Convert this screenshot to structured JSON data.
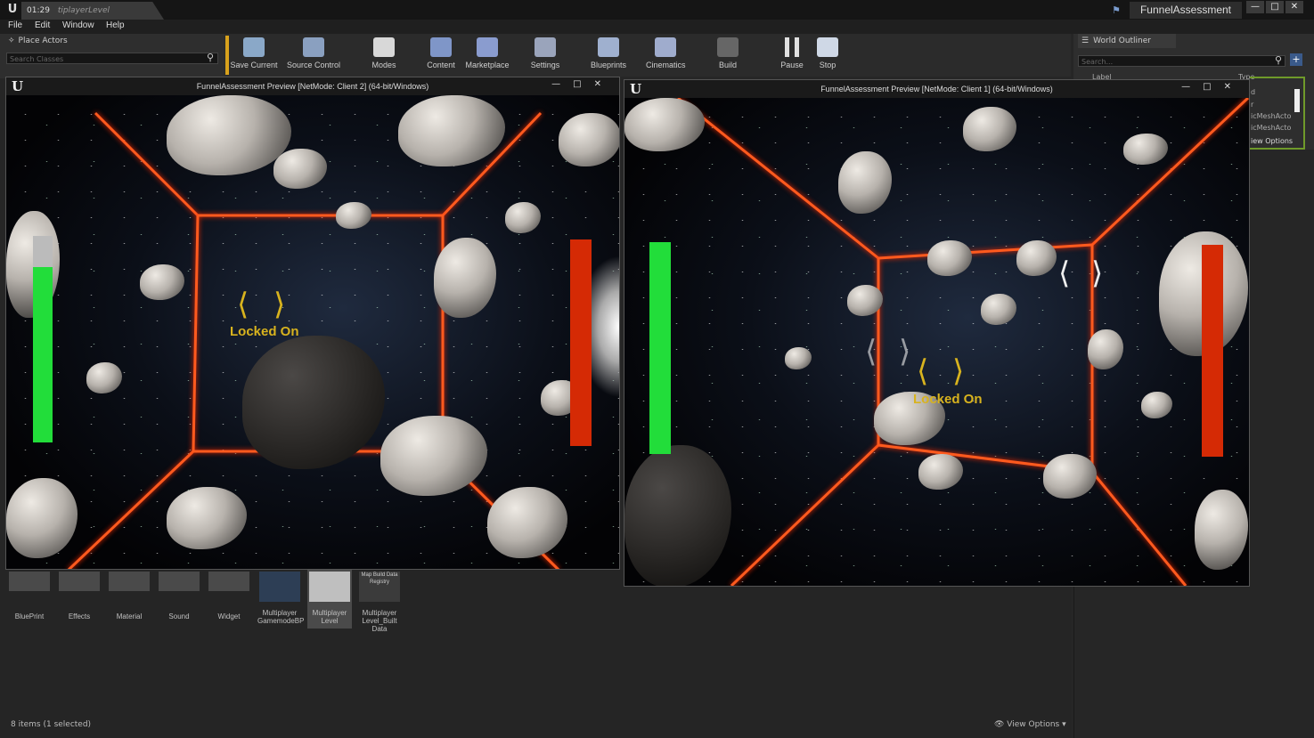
{
  "titlebar": {
    "time": "01:29",
    "level_tab": "tiplayerLevel",
    "project_name": "FunnelAssessment"
  },
  "menu": [
    "File",
    "Edit",
    "Window",
    "Help"
  ],
  "place_actors": {
    "tab_label": "Place Actors",
    "search_placeholder": "Search Classes"
  },
  "toolbar": [
    {
      "label": "Save Current",
      "icon": "save-icon",
      "color": "#8aa8c8"
    },
    {
      "label": "Source Control",
      "icon": "source-control-icon",
      "color": "#8aa0c0"
    },
    {
      "label": "Modes",
      "icon": "modes-icon",
      "color": "#d8d8d8"
    },
    {
      "label": "Content",
      "icon": "content-icon",
      "color": "#7f96c8"
    },
    {
      "label": "Marketplace",
      "icon": "marketplace-icon",
      "color": "#8a9ccf"
    },
    {
      "label": "Settings",
      "icon": "settings-icon",
      "color": "#9aa4bb"
    },
    {
      "label": "Blueprints",
      "icon": "blueprints-icon",
      "color": "#9fb0cf"
    },
    {
      "label": "Cinematics",
      "icon": "cinematics-icon",
      "color": "#9faccd"
    },
    {
      "label": "Build",
      "icon": "build-icon",
      "color": "#666666"
    },
    {
      "label": "Pause",
      "icon": "pause-icon",
      "color": "#e0e0e0"
    },
    {
      "label": "Stop",
      "icon": "stop-icon",
      "color": "#cfd8e6"
    }
  ],
  "world_outliner": {
    "tab_label": "World Outliner",
    "search_placeholder": "Search...",
    "col_label": "Label",
    "col_type": "Type",
    "rows": [
      "d",
      "r",
      "icMeshActo",
      "icMeshActo"
    ],
    "view_options": "iew Options"
  },
  "client2_window": {
    "title": "FunnelAssessment Preview [NetMode: Client 2]  (64-bit/Windows)",
    "locked_on": "Locked On",
    "health_fraction": 0.85,
    "health_color": "#22dd3a",
    "enemy_health_fraction": 1.0,
    "enemy_color": "#d52a05"
  },
  "client1_window": {
    "title": "FunnelAssessment Preview [NetMode: Client 1]  (64-bit/Windows)",
    "locked_on": "Locked On",
    "health_fraction": 1.0,
    "health_color": "#22dd3a",
    "enemy_health_fraction": 1.0,
    "enemy_color": "#d52a05"
  },
  "content_browser": {
    "assets": [
      {
        "label": "BluePrint"
      },
      {
        "label": "Effects"
      },
      {
        "label": "Material"
      },
      {
        "label": "Sound"
      },
      {
        "label": "Widget"
      },
      {
        "label": "Multiplayer GamemodeBP"
      },
      {
        "label": "Multiplayer Level"
      },
      {
        "label": "Multiplayer Level_Built Data",
        "thumb_text": "Map Build Data Registry"
      }
    ],
    "item_count": "8 items (1 selected)",
    "view_options": "View Options"
  }
}
